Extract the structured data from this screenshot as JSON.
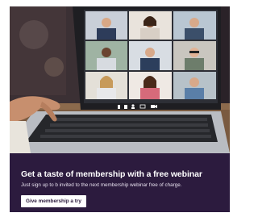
{
  "promo": {
    "headline": "Get a taste of membership with a free webinar",
    "subtext": "Just sign up to b invited to the next membership webinar free of charge.",
    "cta_label": "Give membership a try",
    "colors": {
      "panel": "#2c1b3e",
      "button_bg": "#ffffff",
      "button_text": "#2c1b3e"
    }
  },
  "illustration": {
    "subject": "laptop showing a 3x3 video-call grid",
    "controls_icons": [
      "mic-icon",
      "volume-icon",
      "person-icon",
      "screen-icon",
      "camera-icon"
    ]
  }
}
